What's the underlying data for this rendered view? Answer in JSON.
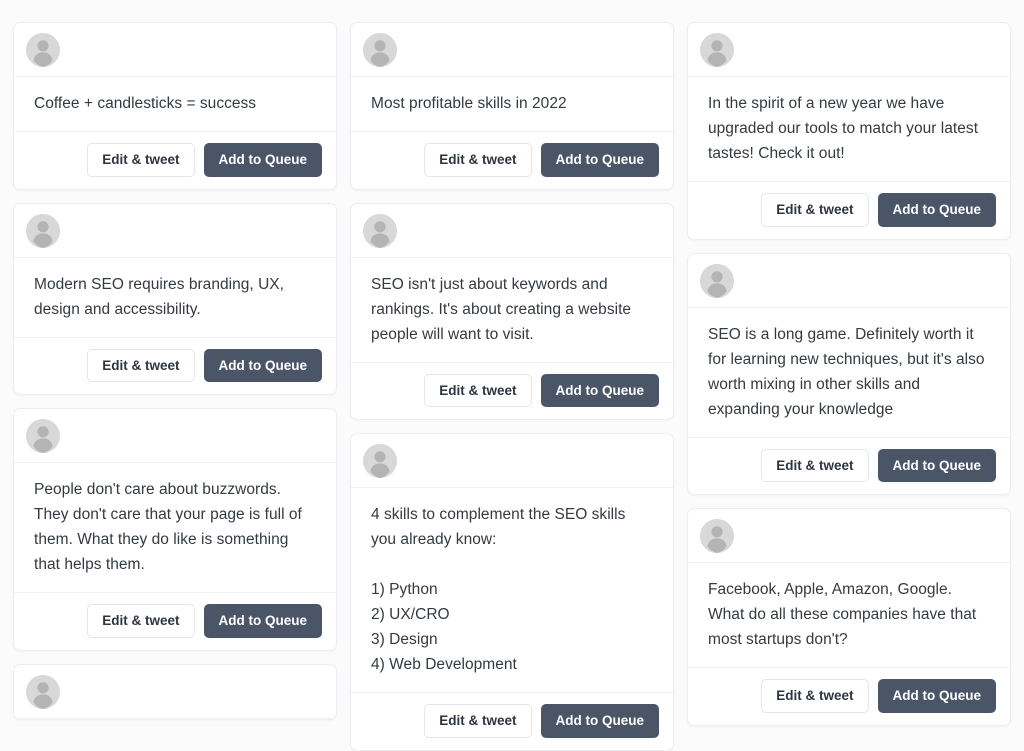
{
  "app": {
    "background_color": "#fbfbfc",
    "card_background": "#ffffff",
    "card_border_color": "#eceef0",
    "text_color": "#333a41",
    "primary_button_color": "#4a5568",
    "secondary_button_text_color": "#2d3540",
    "avatar_color": "#d8d8d8"
  },
  "buttons": {
    "edit_label": "Edit & tweet",
    "queue_label": "Add to Queue"
  },
  "icons": {
    "avatar": "user-placeholder-icon"
  },
  "columns": [
    {
      "id": "column-1",
      "cards": [
        {
          "id": "card-coffee-candlesticks",
          "text": "Coffee + candlesticks = success",
          "partial": false
        },
        {
          "id": "card-modern-seo",
          "text": "Modern SEO requires branding, UX, design and accessibility.",
          "partial": false
        },
        {
          "id": "card-buzzwords",
          "text": "People don't care about buzzwords. They don't care that your page is full of them. What they do like is something that helps them.",
          "partial": false
        },
        {
          "id": "card-column1-partial",
          "text": "",
          "partial": true
        }
      ]
    },
    {
      "id": "column-2",
      "cards": [
        {
          "id": "card-most-profitable-skills",
          "text": "Most profitable skills in 2022",
          "partial": false
        },
        {
          "id": "card-seo-keywords",
          "text": "SEO isn't just about keywords and rankings. It's about creating a website people will want to visit.",
          "partial": false
        },
        {
          "id": "card-4-skills",
          "text": "4 skills to complement the SEO skills you already know:\n\n1) Python\n2) UX/CRO\n3) Design\n4) Web Development",
          "partial": true
        }
      ]
    },
    {
      "id": "column-3",
      "cards": [
        {
          "id": "card-new-year-tools",
          "text": "In the spirit of a new year we have upgraded our tools to match your latest tastes! Check it out!",
          "partial": false
        },
        {
          "id": "card-seo-long-game",
          "text": "SEO is a long game. Definitely worth it for learning new techniques, but it's also worth mixing in other skills and expanding your knowledge",
          "partial": false
        },
        {
          "id": "card-faang",
          "text": "Facebook, Apple, Amazon, Google. What do all these companies have that most startups don't?",
          "partial": true
        }
      ]
    }
  ]
}
